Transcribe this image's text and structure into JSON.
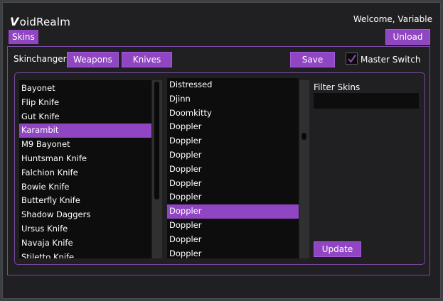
{
  "app": {
    "logo_mark": "V",
    "logo_text": "oidRealm",
    "welcome": "Welcome, Variable"
  },
  "tabs": {
    "skins": "Skins"
  },
  "header_buttons": {
    "unload": "Unload"
  },
  "skinchanger": {
    "label": "Skinchanger",
    "weapons_button": "Weapons",
    "knives_button": "Knives",
    "save_button": "Save",
    "master_switch_label": "Master Switch",
    "master_switch_checked": true
  },
  "knives": {
    "selected_index": 3,
    "items": [
      "Bayonet",
      "Flip Knife",
      "Gut Knife",
      "Karambit",
      "M9 Bayonet",
      "Huntsman Knife",
      "Falchion Knife",
      "Bowie Knife",
      "Butterfly Knife",
      "Shadow Daggers",
      "Ursus Knife",
      "Navaja Knife",
      "Stiletto Knife"
    ]
  },
  "skins": {
    "selected_index": 9,
    "items": [
      "Distressed",
      "Djinn",
      "Doomkitty",
      "Doppler",
      "Doppler",
      "Doppler",
      "Doppler",
      "Doppler",
      "Doppler",
      "Doppler",
      "Doppler",
      "Doppler",
      "Doppler"
    ]
  },
  "filter": {
    "label": "Filter Skins",
    "value": "",
    "placeholder": ""
  },
  "update_button": "Update",
  "colors": {
    "accent": "#9046c2",
    "window_bg": "#201f22",
    "list_bg": "#0d0d0d",
    "border": "#7b4aa2"
  }
}
